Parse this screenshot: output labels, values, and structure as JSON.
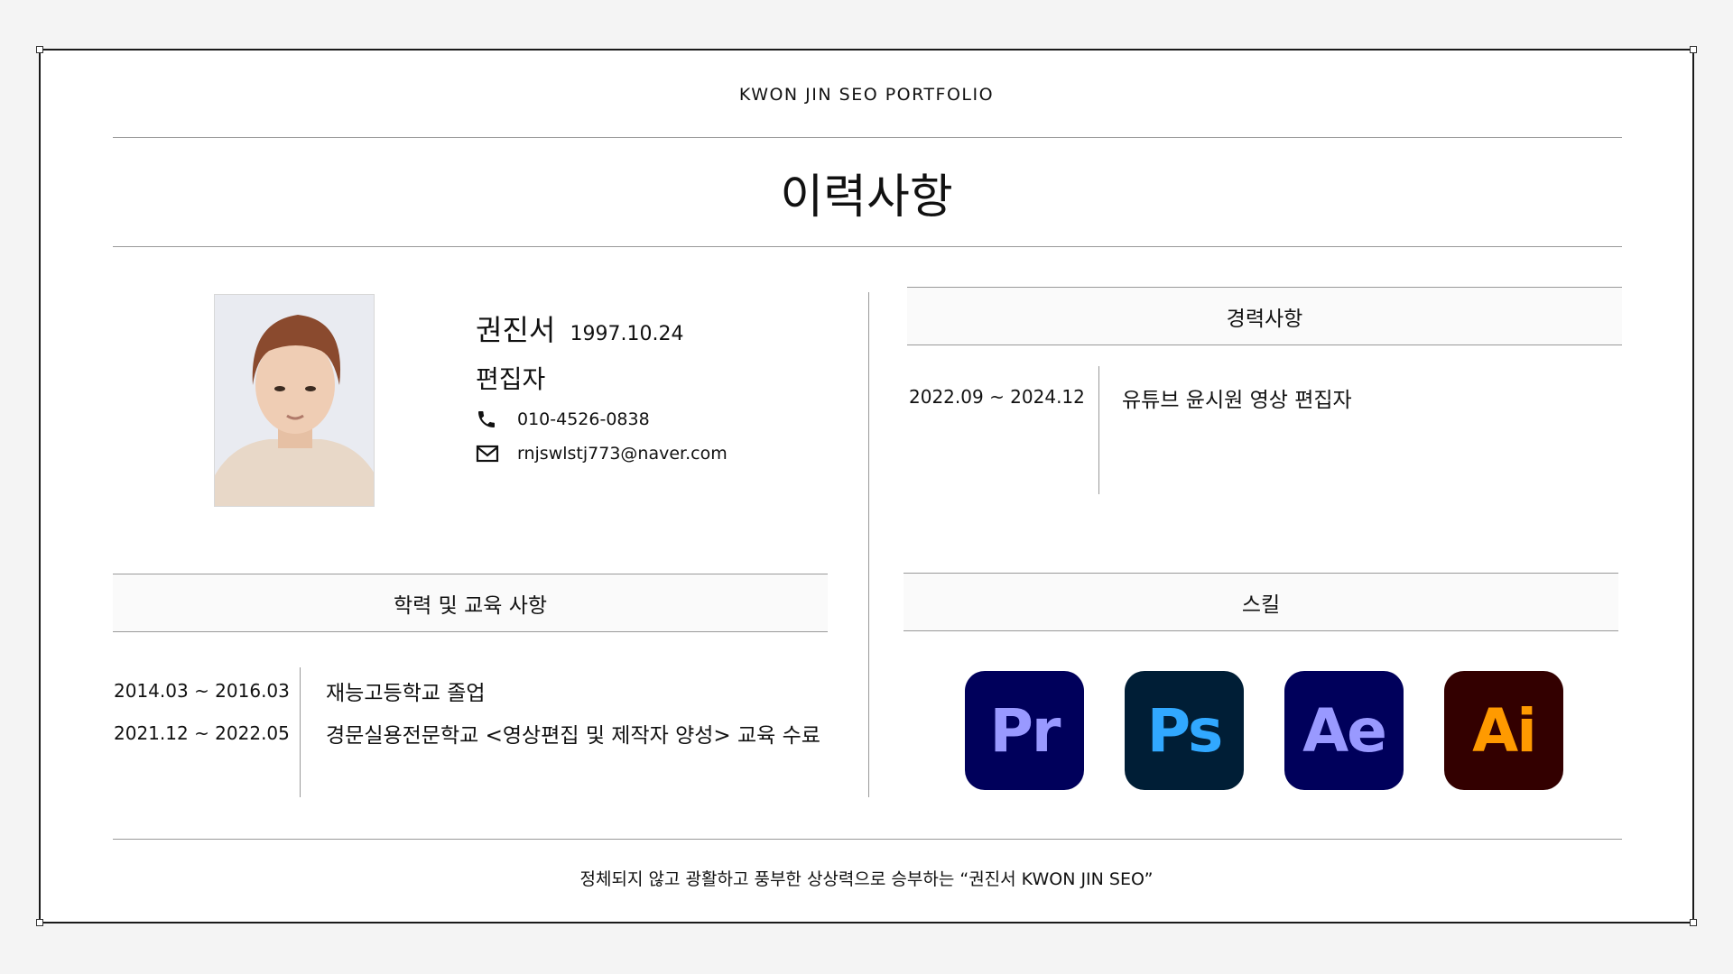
{
  "header": {
    "top_title": "KWON JIN SEO PORTFOLIO",
    "main_title": "이력사항"
  },
  "profile": {
    "name": "권진서",
    "birth": "1997.10.24",
    "role": "편집자",
    "phone": "010-4526-0838",
    "email": "rnjswlstj773@naver.com",
    "phone_icon": "phone-icon",
    "email_icon": "mail-icon"
  },
  "career": {
    "title": "경력사항",
    "items": [
      {
        "period": "2022.09 ~ 2024.12",
        "desc": "유튜브 윤시원 영상 편집자"
      }
    ]
  },
  "education": {
    "title": "학력 및 교육 사항",
    "items": [
      {
        "period": "2014.03 ~ 2016.03",
        "desc": "재능고등학교 졸업"
      },
      {
        "period": "2021.12 ~ 2022.05",
        "desc": "경문실용전문학교 <영상편집 및 제작자 양성> 교육 수료"
      }
    ]
  },
  "skills": {
    "title": "스킬",
    "items": [
      {
        "label": "Pr",
        "bg": "#00005b",
        "fg": "#9999ff"
      },
      {
        "label": "Ps",
        "bg": "#001e36",
        "fg": "#31a8ff"
      },
      {
        "label": "Ae",
        "bg": "#00005b",
        "fg": "#9999ff"
      },
      {
        "label": "Ai",
        "bg": "#330000",
        "fg": "#ff9a00"
      }
    ]
  },
  "footer": {
    "slogan": "정체되지 않고 광활하고 풍부한 상상력으로 승부하는 “권진서 KWON JIN SEO”"
  }
}
